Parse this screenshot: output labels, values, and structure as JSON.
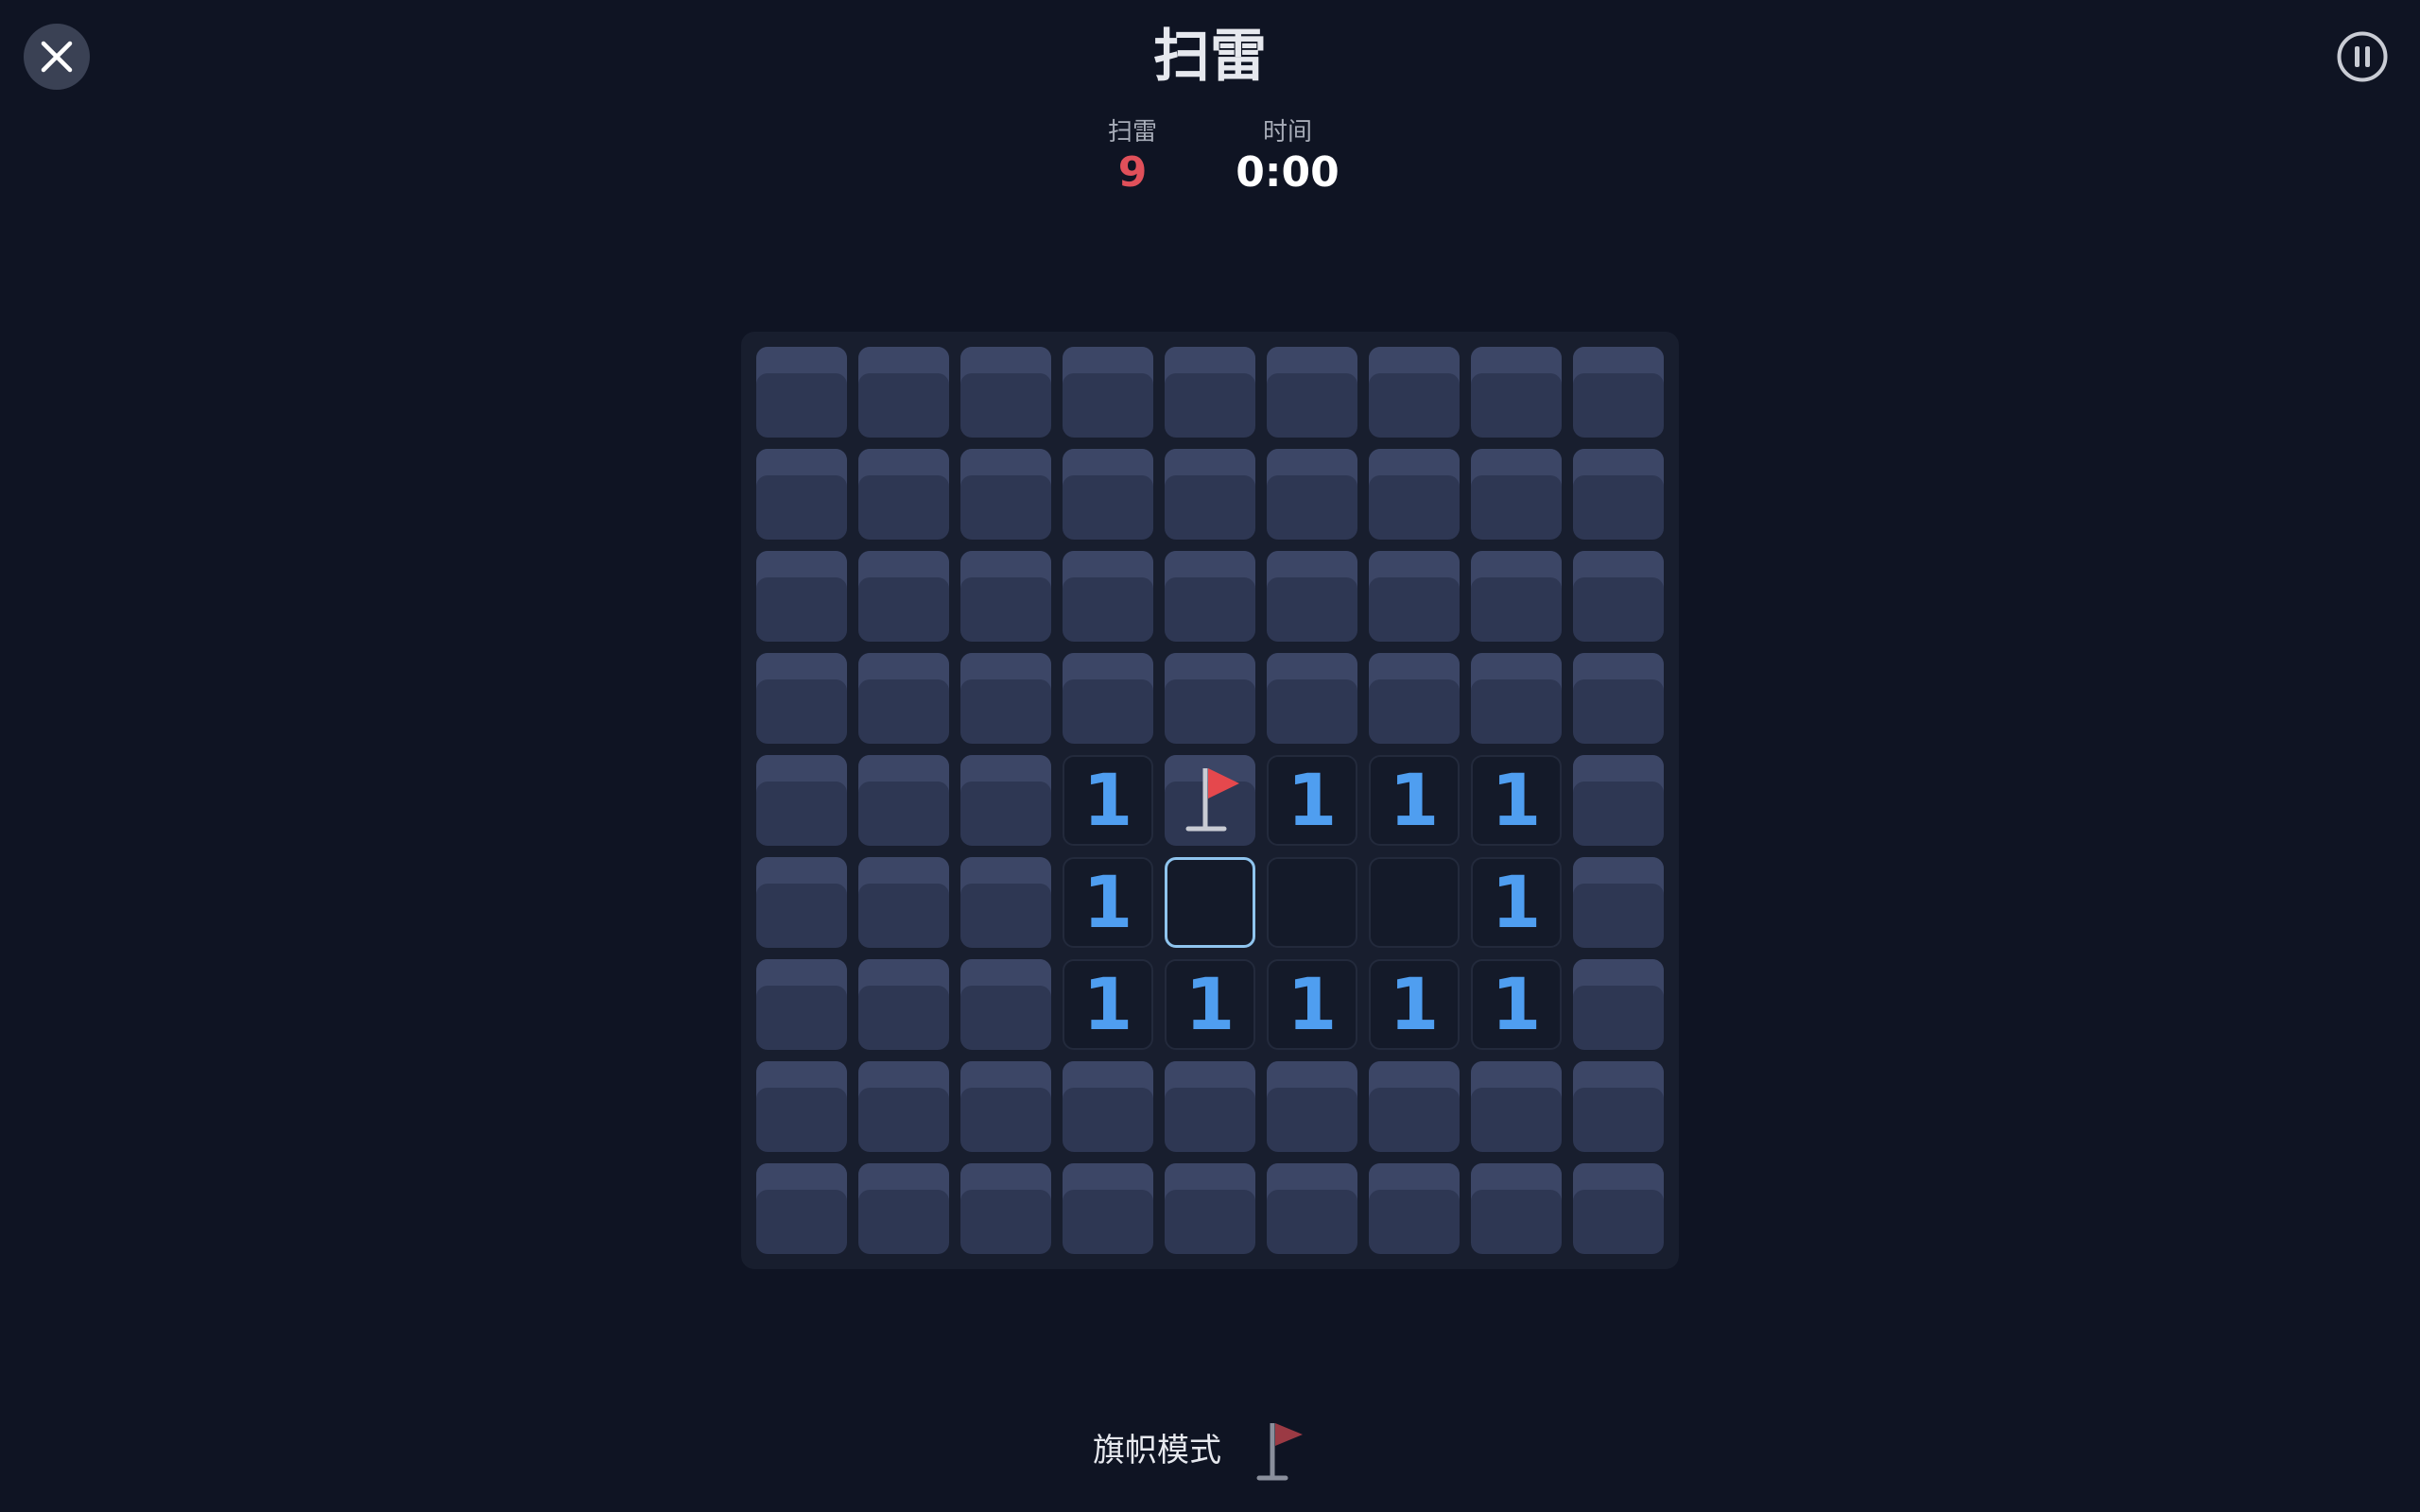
{
  "header": {
    "title": "扫雷",
    "close_icon": "close-icon",
    "pause_icon": "pause-icon"
  },
  "stats": {
    "mines_label": "扫雷",
    "mines_value": "9",
    "time_label": "时间",
    "time_value": "0:00"
  },
  "board": {
    "rows": 9,
    "cols": 9,
    "cells": [
      [
        "h",
        "h",
        "h",
        "h",
        "h",
        "h",
        "h",
        "h",
        "h"
      ],
      [
        "h",
        "h",
        "h",
        "h",
        "h",
        "h",
        "h",
        "h",
        "h"
      ],
      [
        "h",
        "h",
        "h",
        "h",
        "h",
        "h",
        "h",
        "h",
        "h"
      ],
      [
        "h",
        "h",
        "h",
        "h",
        "h",
        "h",
        "h",
        "h",
        "h"
      ],
      [
        "h",
        "h",
        "h",
        "1",
        "F",
        "1",
        "1",
        "1",
        "h"
      ],
      [
        "h",
        "h",
        "h",
        "1",
        "0",
        "0",
        "0",
        "1",
        "h"
      ],
      [
        "h",
        "h",
        "h",
        "1",
        "1",
        "1",
        "1",
        "1",
        "h"
      ],
      [
        "h",
        "h",
        "h",
        "h",
        "h",
        "h",
        "h",
        "h",
        "h"
      ],
      [
        "h",
        "h",
        "h",
        "h",
        "h",
        "h",
        "h",
        "h",
        "h"
      ]
    ],
    "selected_cell": [
      5,
      4
    ],
    "number_color": "#4f9ef0",
    "flag_color": "#e5484d"
  },
  "footer": {
    "flag_mode_label": "旗帜模式",
    "flag_mode_icon": "flag-icon"
  }
}
